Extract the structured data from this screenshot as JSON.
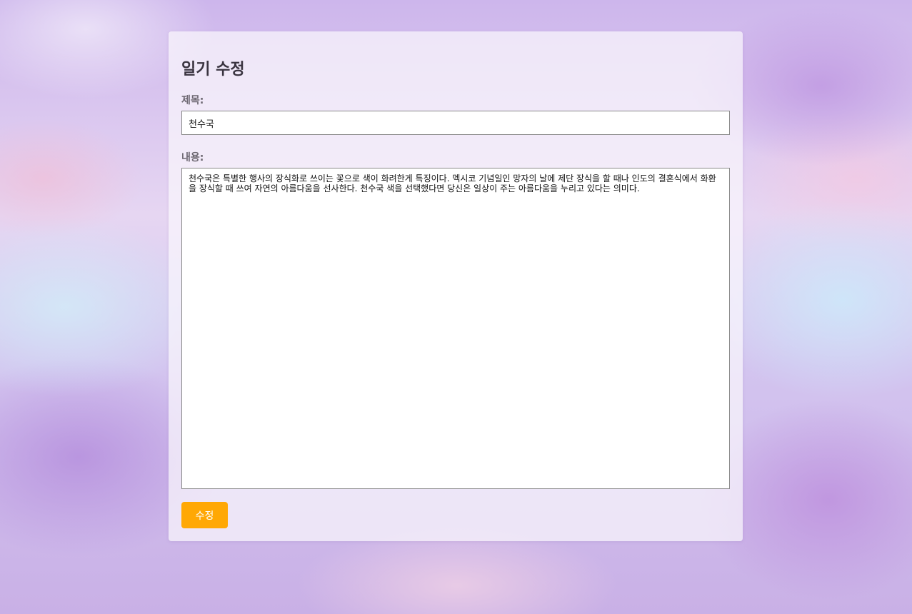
{
  "form": {
    "heading": "일기 수정",
    "title_label": "제목:",
    "title_value": "천수국",
    "content_label": "내용:",
    "content_value": "천수국은 특별한 행사의 장식화로 쓰이는 꽃으로 색이 화려한게 특징이다. 멕시코 기념일인 망자의 날에 제단 장식을 할 때나 인도의 결혼식에서 화환을 장식할 때 쓰여 자연의 아름다움을 선사한다. 천수국 색을 선택했다면 당신은 일상이 주는 아름다움을 누리고 있다는 의미다.",
    "submit_label": "수정"
  },
  "colors": {
    "submit_button": "#ffa805",
    "heading_text": "#3a3440",
    "label_text": "#6b6670"
  }
}
